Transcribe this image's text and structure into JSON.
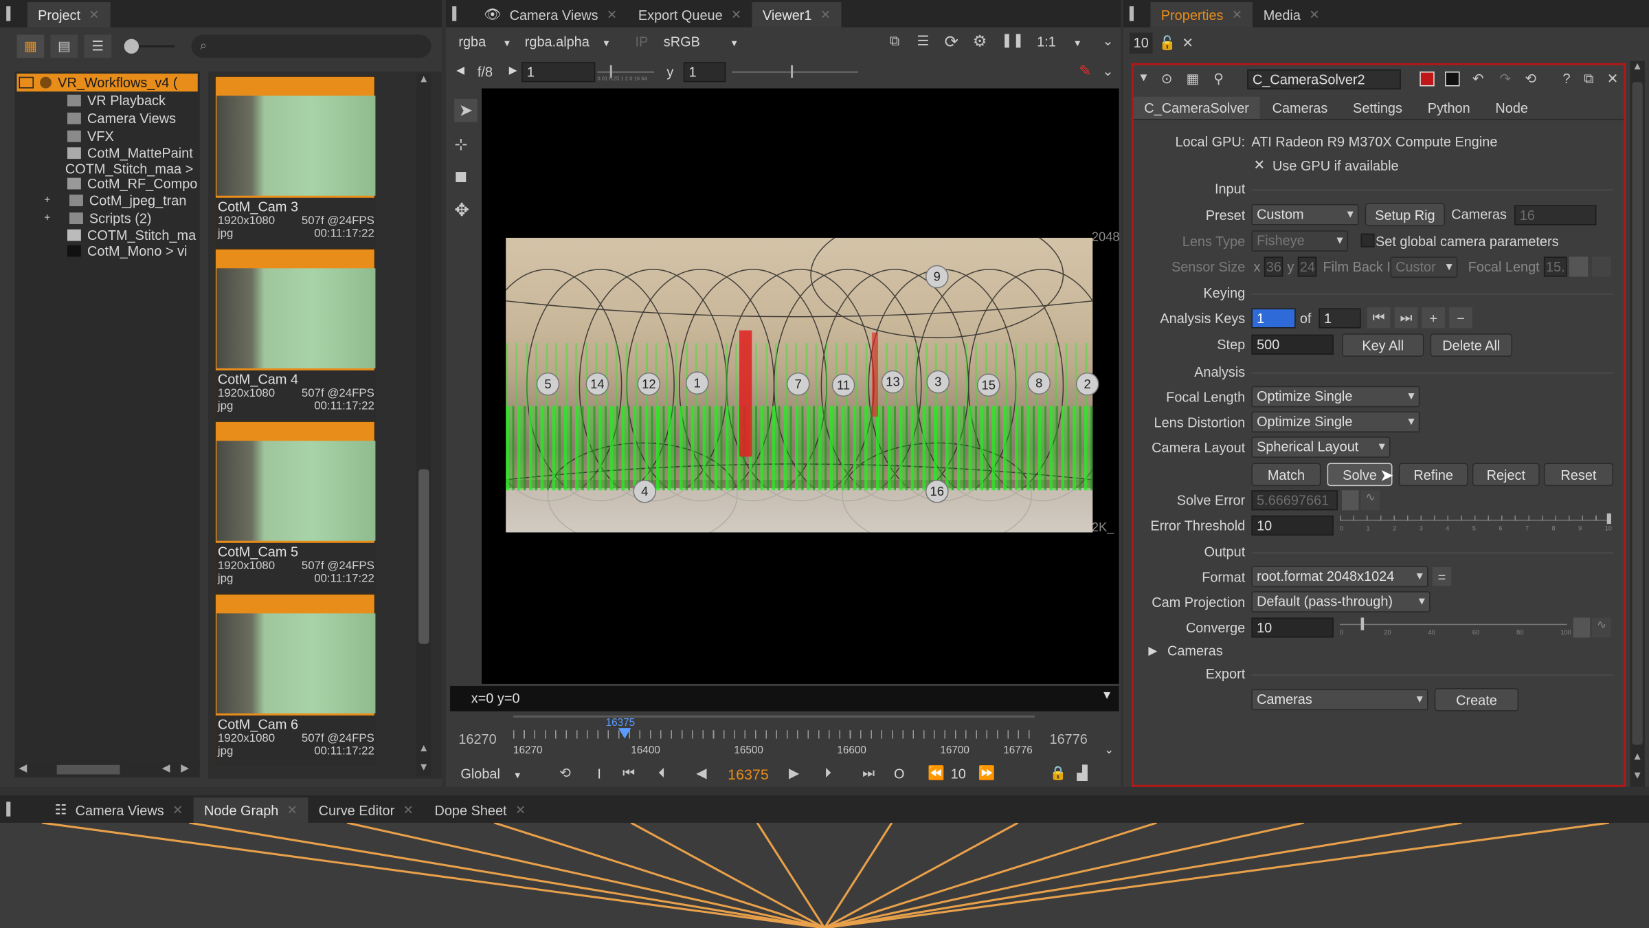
{
  "project_panel": {
    "tab": "Project",
    "tree": [
      {
        "label": "VR_Workflows_v4 ("
      },
      {
        "label": "VR Playback"
      },
      {
        "label": "Camera Views"
      },
      {
        "label": "VFX"
      },
      {
        "label": "CotM_MattePaint"
      },
      {
        "label": "COTM_Stitch_maa >"
      },
      {
        "label": "CotM_RF_Compo"
      },
      {
        "label": "CotM_jpeg_tran"
      },
      {
        "label": "Scripts (2)"
      },
      {
        "label": "COTM_Stitch_ma"
      },
      {
        "label": "CotM_Mono > vi"
      }
    ],
    "thumbnails": [
      {
        "name": "CotM_Cam 3",
        "res": "1920x1080",
        "frames": "507f @24FPS",
        "ext": "jpg",
        "tc": "00:11:17:22"
      },
      {
        "name": "CotM_Cam 4",
        "res": "1920x1080",
        "frames": "507f @24FPS",
        "ext": "jpg",
        "tc": "00:11:17:22"
      },
      {
        "name": "CotM_Cam 5",
        "res": "1920x1080",
        "frames": "507f @24FPS",
        "ext": "jpg",
        "tc": "00:11:17:22"
      },
      {
        "name": "CotM_Cam 6",
        "res": "1920x1080",
        "frames": "507f @24FPS",
        "ext": "jpg",
        "tc": "00:11:17:22"
      }
    ]
  },
  "viewer": {
    "tabs": [
      "Camera Views",
      "Export Queue",
      "Viewer1"
    ],
    "channels": "rgba",
    "alpha": "rgba.alpha",
    "ip": "IP",
    "colorspace": "sRGB",
    "zoom": "1:1",
    "fstop": "f/8",
    "gain": "1",
    "gamma_label": "y",
    "gamma": "1",
    "gain_ticks": "0.01 0.25 1 2.0 16 64",
    "size_label_top": "2048",
    "size_label_bottom": "2K_",
    "coords": "x=0 y=0",
    "markers": [
      "9",
      "5",
      "14",
      "12",
      "1",
      "7",
      "11",
      "13",
      "3",
      "15",
      "8",
      "2",
      "4",
      "16"
    ],
    "timeline": {
      "start": "16270",
      "end": "16776",
      "current": "16375",
      "ticks": [
        "16270",
        "16400",
        "16500",
        "16600",
        "16700",
        "16776"
      ],
      "current_frame": "16375",
      "mode": "Global",
      "in_label": "I",
      "out_label": "O",
      "step": "10"
    }
  },
  "properties": {
    "tabs": [
      "Properties",
      "Media"
    ],
    "count": "10",
    "node_name": "C_CameraSolver2",
    "node_tabs": [
      "C_CameraSolver",
      "Cameras",
      "Settings",
      "Python",
      "Node"
    ],
    "local_gpu_label": "Local GPU:",
    "local_gpu_value": "ATI Radeon R9 M370X Compute Engine",
    "use_gpu": "Use GPU if available",
    "input_section": "Input",
    "preset_label": "Preset",
    "preset_value": "Custom",
    "setup_rig": "Setup Rig",
    "cameras_label": "Cameras",
    "cameras_value": "16",
    "lens_type_label": "Lens Type",
    "lens_type_value": "Fisheye",
    "set_global": "Set global camera parameters",
    "sensor_size_label": "Sensor Size",
    "sensor_x_label": "x",
    "sensor_x": "36",
    "sensor_y_label": "y",
    "sensor_y": "24",
    "film_back_label": "Film Back I",
    "film_back_value": "Custor",
    "focal_length_label": "Focal Lengt",
    "focal_length_value": "15.",
    "keying_section": "Keying",
    "analysis_keys_label": "Analysis Keys",
    "analysis_keys_value": "1",
    "of_label": "of",
    "of_value": "1",
    "step_label": "Step",
    "step_value": "500",
    "key_all": "Key All",
    "delete_all": "Delete All",
    "analysis_section": "Analysis",
    "focal_length_mode_label": "Focal Length",
    "focal_length_mode": "Optimize Single",
    "lens_distortion_label": "Lens Distortion",
    "lens_distortion": "Optimize Single",
    "camera_layout_label": "Camera Layout",
    "camera_layout": "Spherical Layout",
    "match": "Match",
    "solve": "Solve",
    "refine": "Refine",
    "reject": "Reject",
    "reset": "Reset",
    "solve_error_label": "Solve Error",
    "solve_error": "5.66697661",
    "error_threshold_label": "Error Threshold",
    "error_threshold": "10",
    "threshold_ticks": [
      "0",
      "1",
      "2",
      "3",
      "4",
      "5",
      "6",
      "7",
      "8",
      "9",
      "10"
    ],
    "output_section": "Output",
    "format_label": "Format",
    "format_value": "root.format 2048x1024",
    "cam_projection_label": "Cam Projection",
    "cam_projection": "Default (pass-through)",
    "converge_label": "Converge",
    "converge": "10",
    "converge_ticks": [
      "0",
      "20",
      "40",
      "60",
      "80",
      "100"
    ],
    "cameras_group": "Cameras",
    "export_section": "Export",
    "export_value": "Cameras",
    "create": "Create"
  },
  "bottom_tabs": [
    "Camera Views",
    "Node Graph",
    "Curve Editor",
    "Dope Sheet"
  ],
  "colors": {
    "accent": "#e88d1a",
    "selection": "#2f6bd8",
    "red_border": "#b01818",
    "points": "#22ee22"
  }
}
